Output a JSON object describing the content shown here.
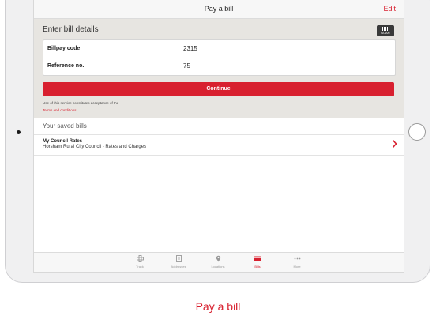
{
  "header": {
    "title": "Pay a bill",
    "edit_label": "Edit"
  },
  "bill_form": {
    "heading": "Enter bill details",
    "scan_label": "SCAN",
    "fields": [
      {
        "label": "Billpay code",
        "value": "2315"
      },
      {
        "label": "Reference no.",
        "value": "75"
      }
    ],
    "continue_label": "Continue",
    "terms_text": "Use of this service constitutes acceptance of the",
    "terms_link": "Terms and conditions"
  },
  "saved_bills": {
    "heading": "Your saved bills",
    "items": [
      {
        "title": "My Council Rates",
        "subtitle": "Horsham Rural City Council - Rates and Charges"
      }
    ]
  },
  "tabs": [
    {
      "label": "Track",
      "icon": "track-icon"
    },
    {
      "label": "Addresses",
      "icon": "addresses-icon"
    },
    {
      "label": "Locations",
      "icon": "location-pin-icon"
    },
    {
      "label": "Bills",
      "icon": "card-icon",
      "active": true
    },
    {
      "label": "More",
      "icon": "more-dots-icon"
    }
  ],
  "caption": "Pay a bill",
  "colors": {
    "accent": "#d8202f",
    "panel": "#e7e5e1"
  }
}
